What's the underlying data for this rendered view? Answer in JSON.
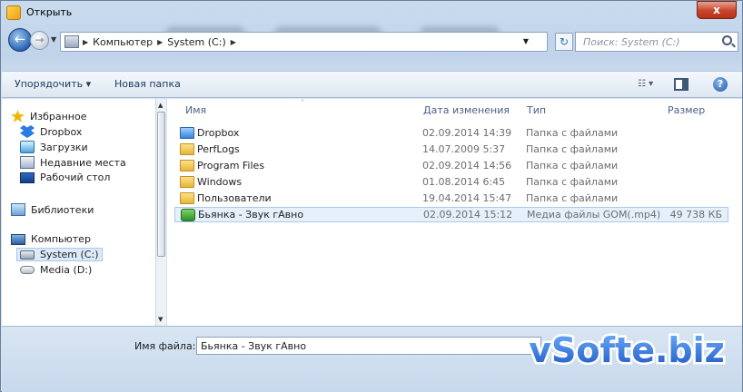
{
  "window": {
    "title": "Открыть",
    "close_label": "x"
  },
  "address": {
    "crumbs": [
      "Компьютер",
      "System (C:)"
    ],
    "search_placeholder": "Поиск: System (C:)"
  },
  "toolbar": {
    "organize": "Упорядочить ▾",
    "new_folder": "Новая папка",
    "views": "☷ ▾",
    "help": "?"
  },
  "nav": {
    "favorites": "Избранное",
    "dropbox": "Dropbox",
    "downloads": "Загрузки",
    "recent": "Недавние места",
    "desktop": "Рабочий стол",
    "libraries": "Библиотеки",
    "computer": "Компьютер",
    "system_c": "System (C:)",
    "media_d": "Media (D:)"
  },
  "columns": {
    "name": "Имя",
    "date": "Дата изменения",
    "type": "Тип",
    "size": "Размер"
  },
  "files": [
    {
      "name": "Dropbox",
      "date": "02.09.2014 14:39",
      "type": "Папка с файлами",
      "size": "",
      "icon": "dropbox-folder-icon"
    },
    {
      "name": "PerfLogs",
      "date": "14.07.2009 5:37",
      "type": "Папка с файлами",
      "size": "",
      "icon": "folder-icon"
    },
    {
      "name": "Program Files",
      "date": "02.09.2014 14:56",
      "type": "Папка с файлами",
      "size": "",
      "icon": "folder-icon"
    },
    {
      "name": "Windows",
      "date": "01.08.2014 6:45",
      "type": "Папка с файлами",
      "size": "",
      "icon": "folder-icon"
    },
    {
      "name": "Пользователи",
      "date": "19.04.2014 15:47",
      "type": "Папка с файлами",
      "size": "",
      "icon": "folder-icon"
    },
    {
      "name": "Бьянка - Звук гАвно",
      "date": "02.09.2014 15:12",
      "type": "Медиа файлы GOM(.mp4)",
      "size": "49 738 КБ",
      "icon": "media-file-icon"
    }
  ],
  "filename": {
    "label": "Имя файла:",
    "value": "Бьянка - Звук гАвно"
  },
  "watermark": {
    "text": "vSofte.biz"
  },
  "colors": {
    "selection": "#e5f0fb",
    "header_text": "#4d6185",
    "watermark_fill": "#2c6fd6"
  }
}
